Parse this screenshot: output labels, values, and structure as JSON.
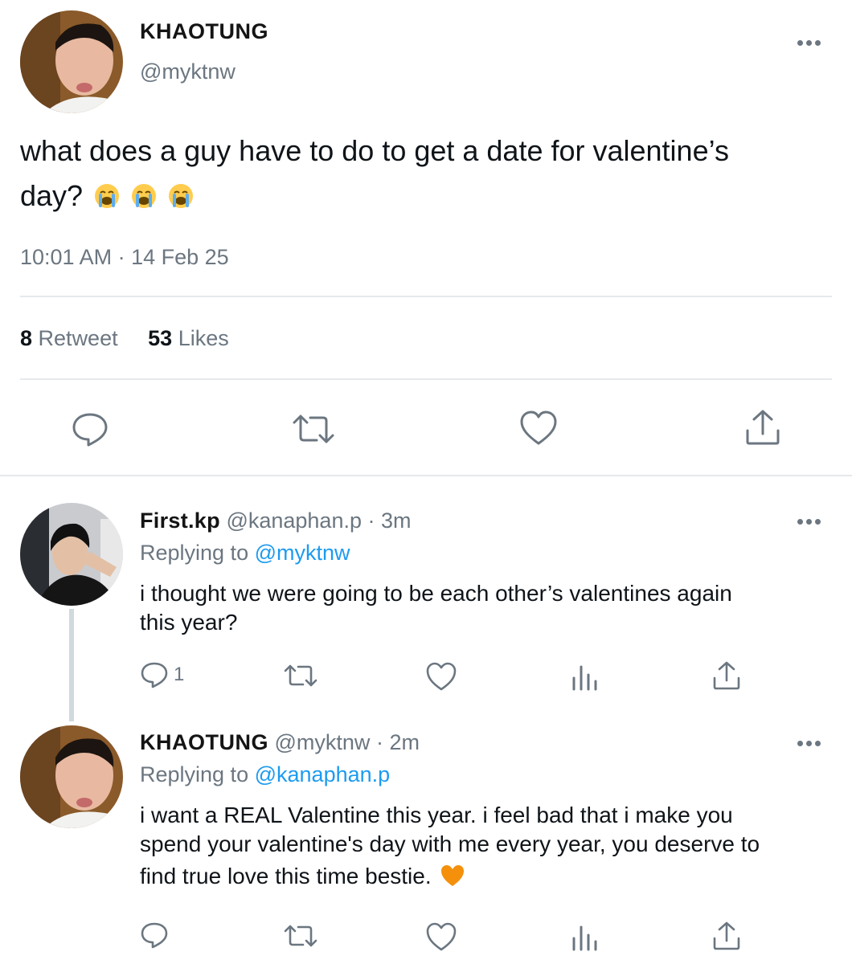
{
  "colors": {
    "accent": "#1d9bf0",
    "grey": "#6b7680",
    "divider": "#e6e9ec",
    "heart_emoji": "#f4900c"
  },
  "main_tweet": {
    "display_name": "KHAOTUNG",
    "handle": "@myktnw",
    "text": "what does a guy have to do to get a date for valentine’s",
    "text_line2": "day?",
    "emojis": [
      "loudly-crying-face",
      "loudly-crying-face",
      "loudly-crying-face"
    ],
    "timestamp": "10:01 AM · 14 Feb 25",
    "stats": {
      "retweet_count": "8",
      "retweet_label": "Retweet",
      "likes_count": "53",
      "likes_label": "Likes"
    },
    "actions": [
      "reply-icon",
      "retweet-icon",
      "like-icon",
      "share-icon"
    ]
  },
  "replies": [
    {
      "display_name": "First.kp",
      "handle": "@kanaphan.p",
      "time": "· 3m",
      "replying_prefix": "Replying to",
      "replying_to": "@myktnw",
      "text_line1": "i thought we were going to be each other’s valentines again",
      "text_line2": "this year?",
      "reply_count": "1",
      "actions": [
        "reply-icon",
        "retweet-icon",
        "like-icon",
        "analytics-icon",
        "share-icon"
      ]
    },
    {
      "display_name": "KHAOTUNG",
      "handle": "@myktnw",
      "time": "· 2m",
      "replying_prefix": "Replying to",
      "replying_to": "@kanaphan.p",
      "text_line1": "i want a REAL Valentine this year. i feel bad that i make you",
      "text_line2": "spend your valentine's day with me every year, you deserve to",
      "text_line3": "find true love this time bestie.",
      "emoji": "orange-heart",
      "reply_count": "",
      "actions": [
        "reply-icon",
        "retweet-icon",
        "like-icon",
        "analytics-icon",
        "share-icon"
      ]
    }
  ]
}
